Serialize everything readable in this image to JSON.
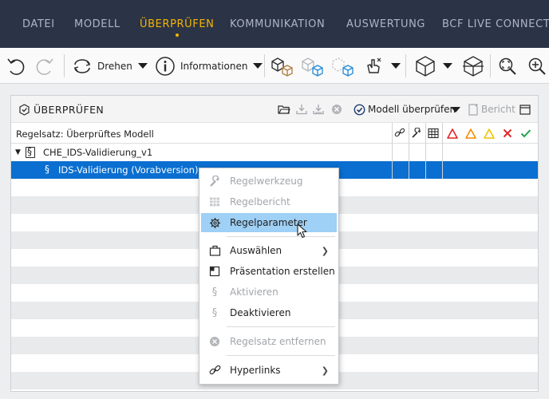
{
  "ribbon_tabs": [
    {
      "label": "DATEI",
      "active": false
    },
    {
      "label": "MODELL",
      "active": false
    },
    {
      "label": "ÜBERPRÜFEN",
      "active": true
    },
    {
      "label": "KOMMUNIKATION",
      "active": false
    },
    {
      "label": "AUSWERTUNG",
      "active": false
    },
    {
      "label": "BCF LIVE CONNECTO",
      "active": false
    }
  ],
  "toolbar": {
    "rotate_label": "Drehen",
    "info_label": "Informationen"
  },
  "panel": {
    "title": "ÜBERPRÜFEN",
    "check_model_label": "Modell überprüfen",
    "report_label": "Bericht",
    "column_header": "Regelsatz: Überprüftes Modell",
    "tree": {
      "ruleset": "CHE_IDS-Validierung_v1",
      "rule": "IDS-Validierung (Vorabversion)"
    }
  },
  "context_menu": {
    "items": [
      {
        "label": "Regelwerkzeug",
        "icon": "wrench-icon",
        "enabled": false
      },
      {
        "label": "Regelbericht",
        "icon": "table-icon",
        "enabled": false
      },
      {
        "label": "Regelparameter",
        "icon": "gear-icon",
        "enabled": true,
        "highlighted": true
      },
      {
        "label": "Auswählen",
        "icon": "select-box-icon",
        "enabled": true,
        "submenu": true
      },
      {
        "label": "Präsentation erstellen",
        "icon": "presentation-icon",
        "enabled": true
      },
      {
        "label": "Aktivieren",
        "icon": "section-icon",
        "enabled": false
      },
      {
        "label": "Deaktivieren",
        "icon": "section-icon",
        "enabled": true
      },
      {
        "label": "Regelsatz entfernen",
        "icon": "remove-circle-icon",
        "enabled": false
      },
      {
        "label": "Hyperlinks",
        "icon": "link-icon",
        "enabled": true,
        "submenu": true
      }
    ]
  },
  "colors": {
    "ribbon_bg": "#2b3447",
    "ribbon_active": "#f4b400",
    "selection": "#0a6fd0",
    "menu_highlight": "#9fd0f5",
    "severity_critical": "#e02424",
    "severity_major": "#f28c00",
    "severity_minor": "#f2c200",
    "rejected": "#e02424",
    "accepted": "#1aa34a"
  }
}
